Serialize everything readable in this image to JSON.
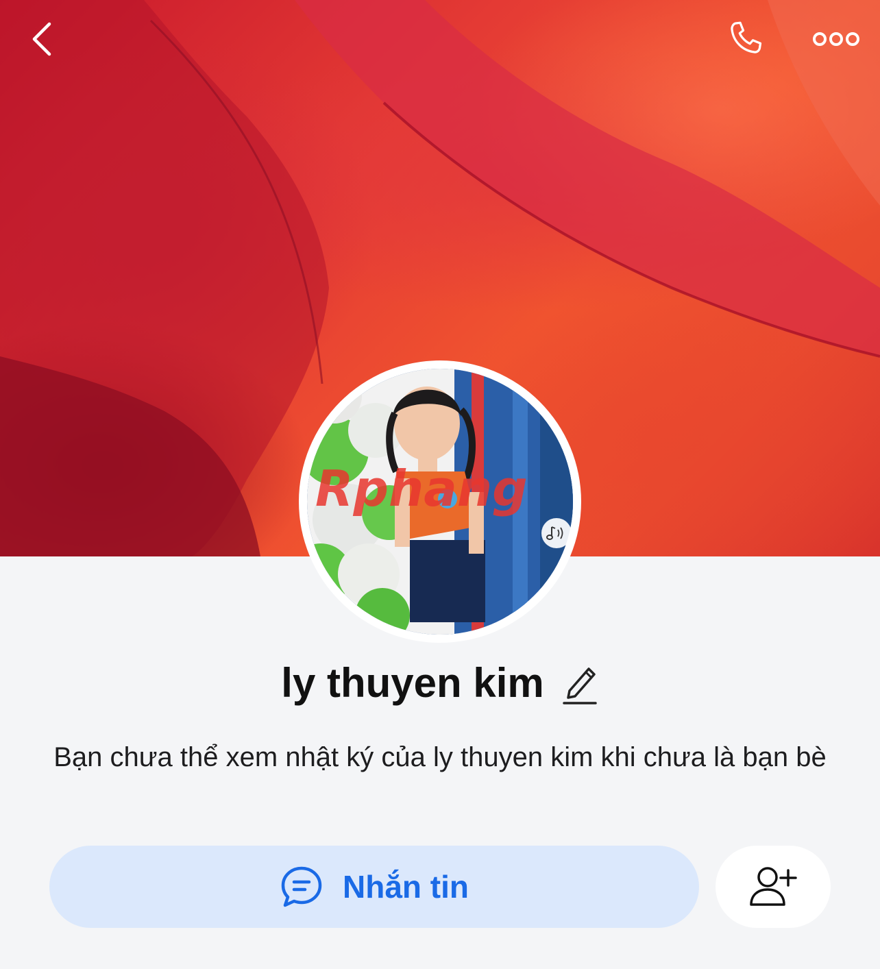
{
  "header": {
    "back_icon": "chevron-left-icon",
    "call_icon": "phone-icon",
    "more_icon": "more-horizontal-icon"
  },
  "cover": {
    "description_colors": [
      "#c8182c",
      "#e43a34",
      "#f0532f"
    ]
  },
  "profile": {
    "name": "ly thuyen kim",
    "edit_icon": "pencil-icon",
    "avatar_watermark": "Rphang",
    "music_icon": "music-note-icon"
  },
  "notice": {
    "text": "Bạn chưa thể xem nhật ký của ly thuyen kim khi chưa là bạn bè"
  },
  "actions": {
    "message_label": "Nhắn tin",
    "message_icon": "chat-bubble-icon",
    "add_friend_icon": "add-friend-icon"
  },
  "colors": {
    "accent": "#1a6ae6",
    "message_button_bg": "#dbe8fc",
    "page_bg": "#f4f5f7"
  }
}
